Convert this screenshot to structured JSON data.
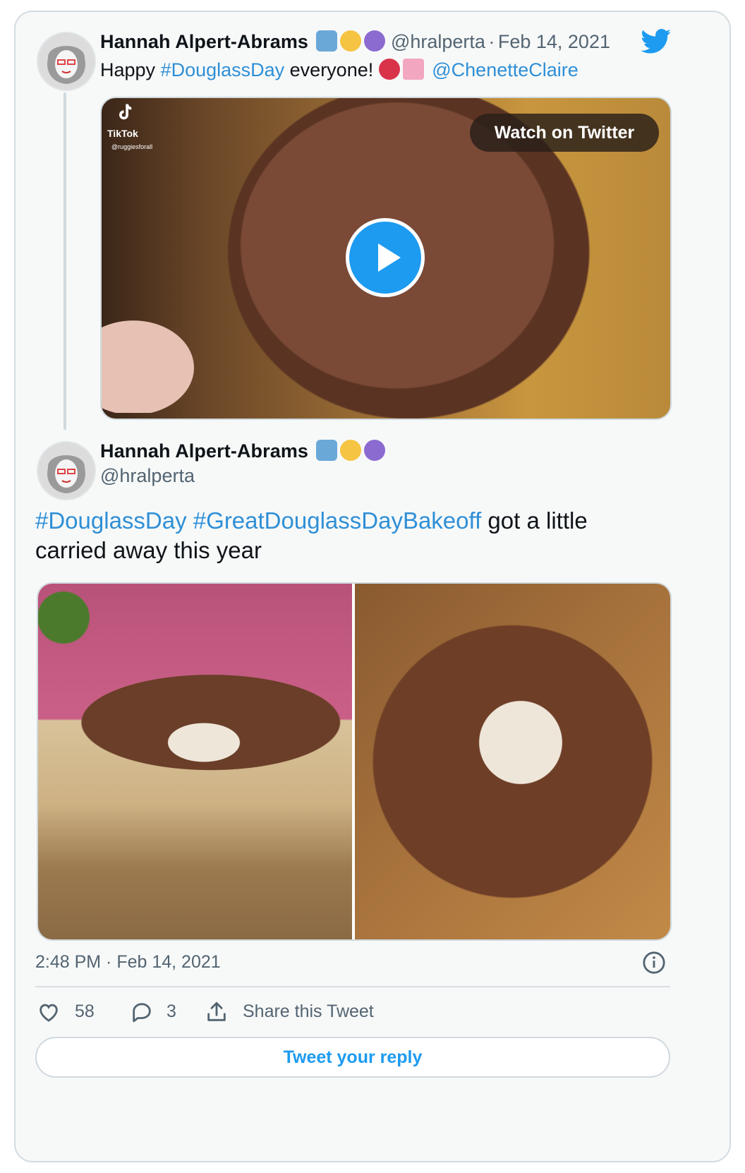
{
  "tweet1": {
    "author_name": "Hannah Alpert-Abrams",
    "handle": "@hralperta",
    "separator": "·",
    "date": "Feb 14, 2021",
    "text_before": "Happy ",
    "hashtag": "#DouglassDay",
    "text_after": " everyone! ",
    "mention": "@ChenetteClaire",
    "video": {
      "watch_label": "Watch on Twitter",
      "tiktok_label": "TikTok",
      "tiktok_handle": "@ruggiesforall"
    }
  },
  "tweet2": {
    "author_name": "Hannah Alpert-Abrams",
    "handle": "@hralperta",
    "hashtag1": "#DouglassDay",
    "hashtag2": "#GreatDouglassDayBakeoff",
    "text_line1_rest": " got a little",
    "text_line2": "carried away this year",
    "timestamp": "2:48 PM · Feb 14, 2021"
  },
  "actions": {
    "likes": "58",
    "replies": "3",
    "share_label": "Share this Tweet",
    "reply_button": "Tweet your reply"
  },
  "colors": {
    "link": "#1d9bf0",
    "meta": "#536471",
    "card_bg": "#f7f9f9"
  },
  "icons": [
    "twitter-bird-icon",
    "robot-emoji",
    "raised-fist-emoji",
    "crystal-ball-emoji",
    "heart-exclamation-emoji",
    "birthday-cake-emoji",
    "play-icon",
    "tiktok-icon",
    "heart-icon",
    "reply-icon",
    "share-icon",
    "info-icon"
  ]
}
